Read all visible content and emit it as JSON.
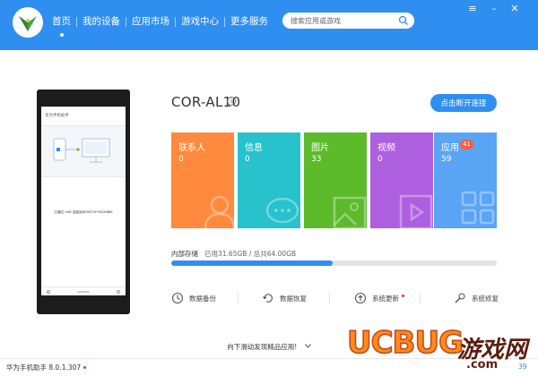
{
  "header": {
    "nav": [
      {
        "label": "首页",
        "active": true
      },
      {
        "label": "我的设备",
        "active": false
      },
      {
        "label": "应用市场",
        "active": false
      },
      {
        "label": "游戏中心",
        "active": false
      },
      {
        "label": "更多服务",
        "active": false
      }
    ],
    "search_placeholder": "搜索应用或游戏",
    "window_controls": {
      "menu": "≡",
      "minimize": "–",
      "close": "✕"
    }
  },
  "phone": {
    "title": "华为手机助手",
    "message": "已通过 USB 连接到DESKTOP-PACR88E"
  },
  "device": {
    "name": "COR-AL10",
    "info_icon": "i",
    "disconnect_label": "点击断开连接"
  },
  "tiles": [
    {
      "label": "联系人",
      "count": "0",
      "color": "#ff8a3d",
      "icon": "contact-icon"
    },
    {
      "label": "信息",
      "count": "0",
      "color": "#27c2cc",
      "icon": "message-icon"
    },
    {
      "label": "图片",
      "count": "33",
      "color": "#5cbb2b",
      "icon": "picture-icon"
    },
    {
      "label": "视频",
      "count": "0",
      "color": "#ad5fe0",
      "icon": "video-icon"
    },
    {
      "label": "应用",
      "count": "59",
      "badge": "41",
      "color": "#5aa4f5",
      "icon": "apps-icon"
    }
  ],
  "storage": {
    "label": "内部存储",
    "detail": "已用31.65GB / 总共64.00GB",
    "used_fraction": 0.4945
  },
  "tools": [
    {
      "label": "数据备份",
      "icon": "backup-icon"
    },
    {
      "label": "数据恢复",
      "icon": "restore-icon"
    },
    {
      "label": "系统更新",
      "icon": "update-icon",
      "has_dot": true
    },
    {
      "label": "系统修复",
      "icon": "repair-icon"
    }
  ],
  "scroll_hint": "向下滑动发现精品应用!",
  "footer": {
    "version": "华为手机助手 8.0.1.307",
    "page_indicator": "39"
  },
  "watermark": {
    "brand": "UCBUG",
    "cn": "游戏网",
    "domain": ".com"
  }
}
